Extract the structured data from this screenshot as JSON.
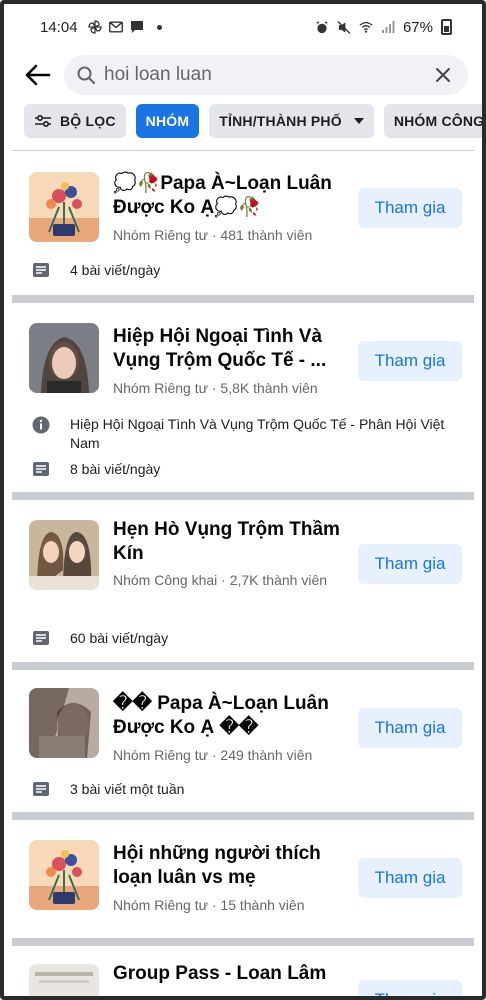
{
  "status_bar": {
    "time": "14:04",
    "battery": "67%"
  },
  "search": {
    "query": "hoi loan luan"
  },
  "filters": [
    {
      "label": "BỘ LỌC",
      "icon": "sliders-icon",
      "active": false
    },
    {
      "label": "NHÓM",
      "active": true
    },
    {
      "label": "TỈNH/THÀNH PHỐ",
      "has_caret": true,
      "active": false
    },
    {
      "label": "NHÓM CÔNG",
      "active": false
    }
  ],
  "results": [
    {
      "title": "💭🥀Papa À~Loạn Luân Được Ko Ạ💭🥀",
      "meta": "Nhóm Riêng tư · 481 thành viên",
      "posts": "4 bài viết/ngày",
      "join_label": "Tham gia",
      "avatar": "illustration-flowers"
    },
    {
      "title": "Hiệp Hội Ngoại Tình Và Vụng Trộm Quốc Tế - ...",
      "meta": "Nhóm Riêng tư · 5,8K thành viên",
      "description": "Hiệp Hội Ngoại Tình Và Vụng Trộm Quốc Tế - Phân Hội Việt Nam",
      "posts": "8 bài viết/ngày",
      "join_label": "Tham gia",
      "avatar": "photo-woman"
    },
    {
      "title": "Hẹn Hò Vụng Trộm Thầm Kín",
      "meta": "Nhóm Công khai · 2,7K thành viên",
      "posts": "60 bài viết/ngày",
      "join_label": "Tham gia",
      "avatar": "photo-two-women"
    },
    {
      "title": "�� Papa À~Loạn Luân Được Ko Ạ ��",
      "meta": "Nhóm Riêng tư · 249 thành viên",
      "posts": "3 bài viết một tuần",
      "join_label": "Tham gia",
      "avatar": "photo-dark"
    },
    {
      "title": "Hội những người thích loạn luân vs mẹ",
      "meta": "Nhóm Riêng tư · 15 thành viên",
      "join_label": "Tham gia",
      "avatar": "illustration-flowers"
    },
    {
      "title": "Group Pass - Loan Lâm",
      "join_label": "Tham gia",
      "avatar": "photo-partial"
    }
  ],
  "colors": {
    "accent": "#1b74e4",
    "join_bg": "#e7f0fd",
    "secondary_text": "#65676b",
    "separator": "#c9ccd1"
  }
}
